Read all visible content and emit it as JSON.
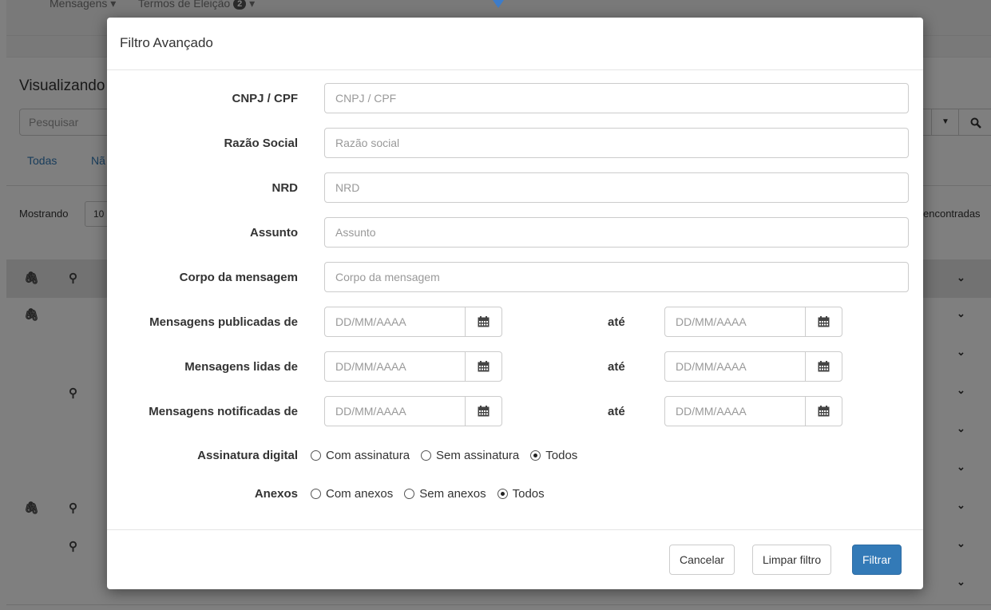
{
  "background": {
    "nav": {
      "mensagens": "Mensagens",
      "termos": "Termos de Eleição",
      "termos_badge": "2"
    },
    "page_title": "Visualizando",
    "search_placeholder": "Pesquisar",
    "tabs": [
      "Todas",
      "Nã"
    ],
    "mostrando": "Mostrando",
    "page_size": "10",
    "found_text": "encontradas"
  },
  "modal": {
    "title": "Filtro Avançado",
    "fields": [
      {
        "label": "CNPJ / CPF",
        "placeholder": "CNPJ / CPF"
      },
      {
        "label": "Razão Social",
        "placeholder": "Razão social"
      },
      {
        "label": "NRD",
        "placeholder": "NRD"
      },
      {
        "label": "Assunto",
        "placeholder": "Assunto"
      },
      {
        "label": "Corpo da mensagem",
        "placeholder": "Corpo da mensagem"
      }
    ],
    "date_ranges": [
      {
        "label": "Mensagens publicadas de",
        "from_placeholder": "DD/MM/AAAA",
        "to_label": "até",
        "to_placeholder": "DD/MM/AAAA"
      },
      {
        "label": "Mensagens lidas de",
        "from_placeholder": "DD/MM/AAAA",
        "to_label": "até",
        "to_placeholder": "DD/MM/AAAA"
      },
      {
        "label": "Mensagens notificadas de",
        "from_placeholder": "DD/MM/AAAA",
        "to_label": "até",
        "to_placeholder": "DD/MM/AAAA"
      }
    ],
    "radio_groups": [
      {
        "label": "Assinatura digital",
        "options": [
          "Com assinatura",
          "Sem assinatura",
          "Todos"
        ],
        "selected": "Todos"
      },
      {
        "label": "Anexos",
        "options": [
          "Com anexos",
          "Sem anexos",
          "Todos"
        ],
        "selected": "Todos"
      }
    ],
    "buttons": {
      "cancel": "Cancelar",
      "clear": "Limpar filtro",
      "filter": "Filtrar"
    }
  },
  "colors": {
    "primary": "#337ab7",
    "overlay": "rgba(0,0,0,0.5)"
  }
}
